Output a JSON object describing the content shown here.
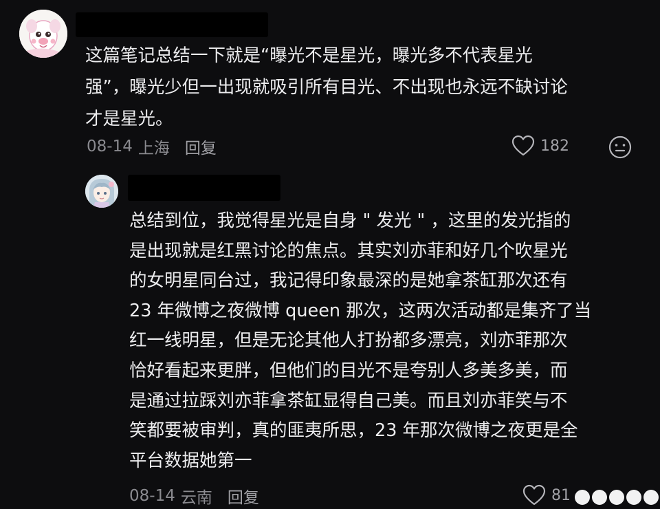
{
  "comment": {
    "author": {
      "avatar_icon": "cartoon-sheep-avatar-icon"
    },
    "text": "这篇笔记总结一下就是“曝光不是星光，曝光多不代表星光\n强”，曝光少但一出现就吸引所有目光、不出现也永远不缺讨论\n才是星光。",
    "date": "08-14",
    "location": "上海",
    "reply_label": "回复",
    "like_count": "182",
    "like_icon": "heart-icon",
    "emoji_icon": "emoji-face-icon"
  },
  "reply": {
    "author": {
      "avatar_icon": "anime-girl-avatar-icon"
    },
    "text": "总结到位，我觉得星光是自身 \" 发光 \" ，这里的发光指的\n是出现就是红黑讨论的焦点。其实刘亦菲和好几个吹星光\n的女明星同台过，我记得印象最深的是她拿茶缸那次还有\n23 年微博之夜微博 queen 那次，这两次活动都是集齐了当\n红一线明星，但是无论其他人打扮都多漂亮，刘亦菲那次\n恰好看起来更胖，但他们的目光不是夸别人多美多美，而\n是通过拉踩刘亦菲拿茶缸显得自己美。而且刘亦菲笑与不\n笑都要被审判，真的匪夷所思，23 年那次微博之夜更是全\n平台数据她第一",
    "date": "08-14",
    "location": "云南",
    "reply_label": "回复",
    "like_count": "81",
    "like_icon": "heart-icon"
  }
}
